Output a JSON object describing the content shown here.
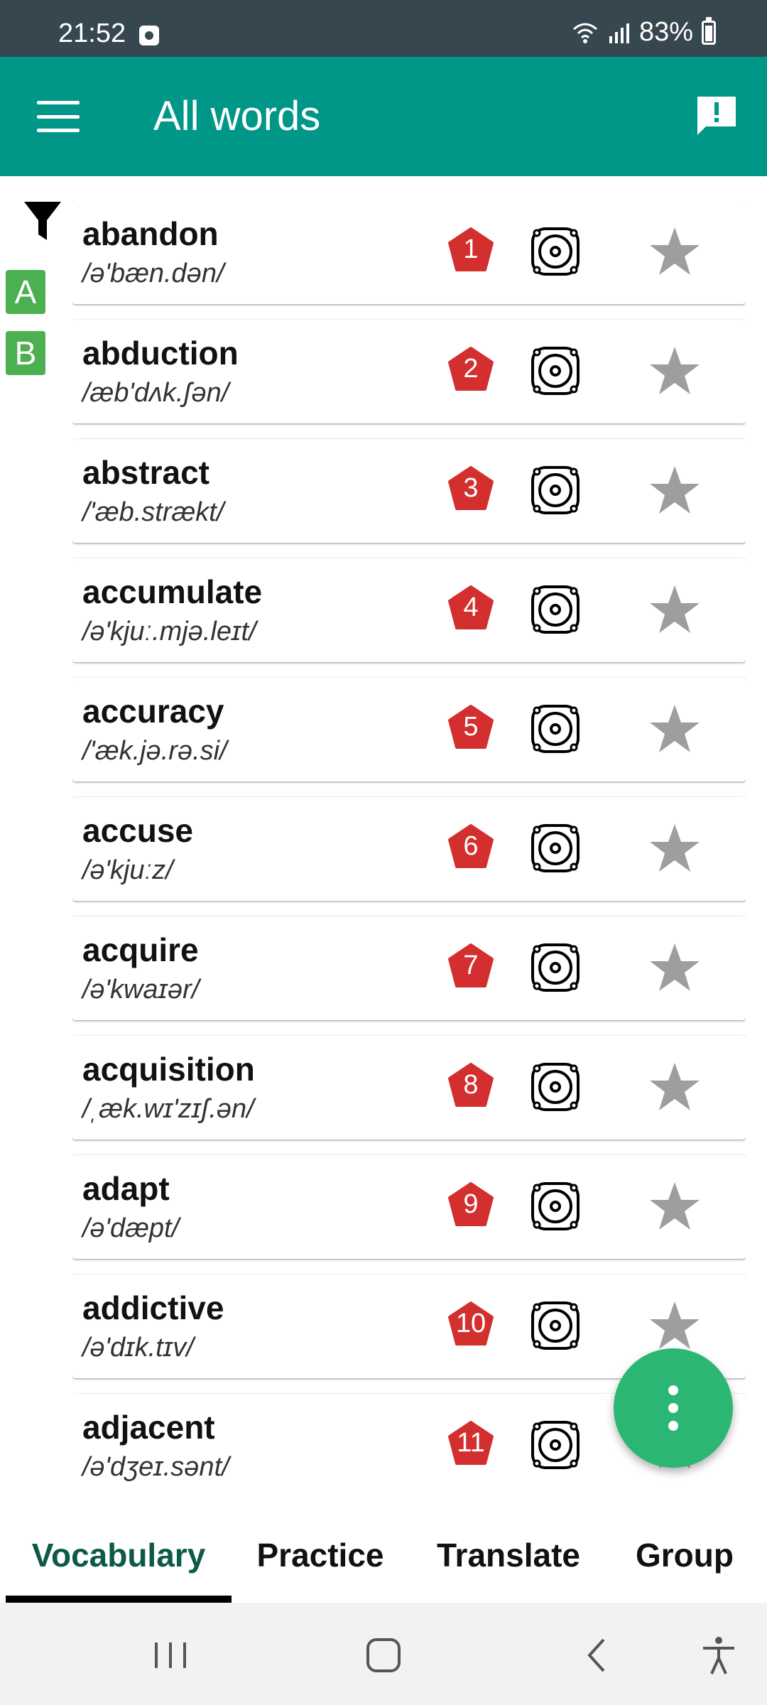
{
  "status_bar": {
    "time": "21:52",
    "battery": "83%"
  },
  "app_bar": {
    "title": "All words"
  },
  "letters": [
    "A",
    "B"
  ],
  "words": [
    {
      "word": "abandon",
      "ipa": "/ə'bæn.dən/",
      "number": "1"
    },
    {
      "word": "abduction",
      "ipa": "/æb'dʌk.ʃən/",
      "number": "2"
    },
    {
      "word": "abstract",
      "ipa": "/'æb.strækt/",
      "number": "3"
    },
    {
      "word": "accumulate",
      "ipa": "/ə'kjuː.mjə.leɪt/",
      "number": "4"
    },
    {
      "word": "accuracy",
      "ipa": "/'æk.jə.rə.si/",
      "number": "5"
    },
    {
      "word": "accuse",
      "ipa": "/ə'kjuːz/",
      "number": "6"
    },
    {
      "word": "acquire",
      "ipa": "/ə'kwaɪər/",
      "number": "7"
    },
    {
      "word": "acquisition",
      "ipa": "/ˌæk.wɪ'zɪʃ.ən/",
      "number": "8"
    },
    {
      "word": "adapt",
      "ipa": "/ə'dæpt/",
      "number": "9"
    },
    {
      "word": "addictive",
      "ipa": "/ə'dɪk.tɪv/",
      "number": "10"
    },
    {
      "word": "adjacent",
      "ipa": "/ə'dʒeɪ.sənt/",
      "number": "11"
    }
  ],
  "tabs": [
    {
      "label": "Vocabulary",
      "active": true
    },
    {
      "label": "Practice",
      "active": false
    },
    {
      "label": "Translate",
      "active": false
    },
    {
      "label": "Group",
      "active": false
    }
  ],
  "colors": {
    "app_bar": "#009688",
    "status_bar": "#37474f",
    "badge": "#d32f2f",
    "letter_tag": "#4caf50",
    "fab": "#2bb673"
  },
  "icons": [
    "menu-icon",
    "feedback-icon",
    "filter-icon",
    "speaker-icon",
    "star-icon",
    "more-vert-icon",
    "recents-icon",
    "home-icon",
    "back-icon",
    "accessibility-icon"
  ]
}
